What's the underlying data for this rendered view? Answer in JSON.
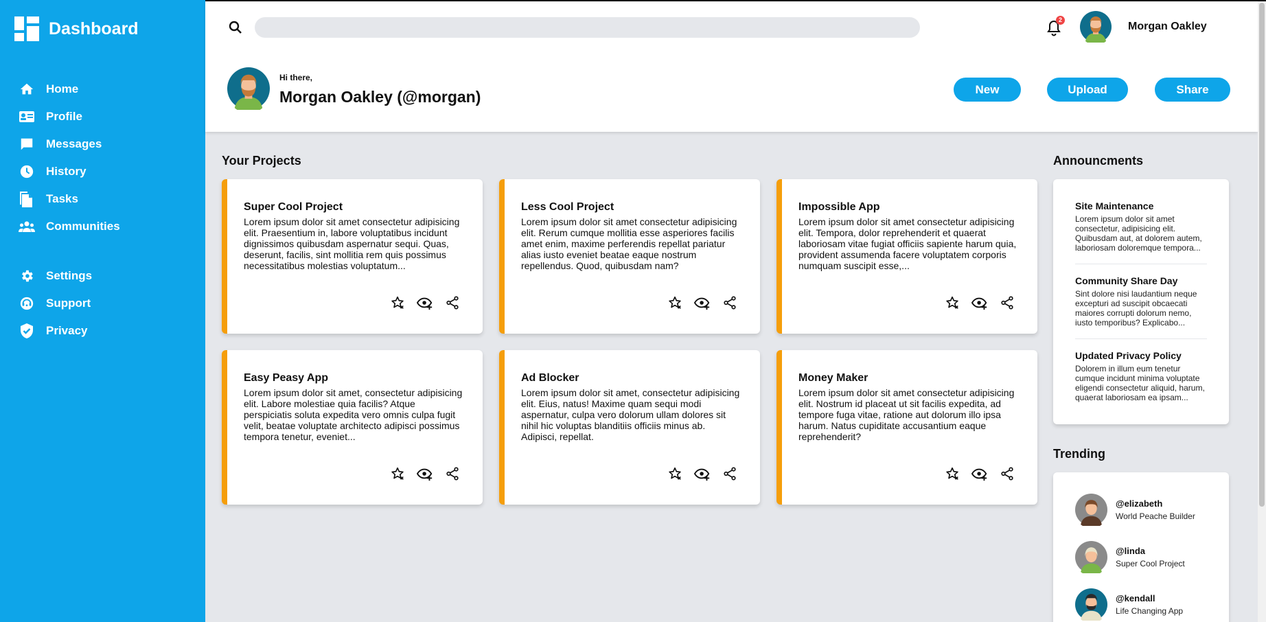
{
  "sidebar": {
    "title": "Dashboard",
    "nav_items": [
      {
        "label": "Home",
        "icon": "home-icon"
      },
      {
        "label": "Profile",
        "icon": "profile-card-icon"
      },
      {
        "label": "Messages",
        "icon": "message-icon"
      },
      {
        "label": "History",
        "icon": "clock-icon"
      },
      {
        "label": "Tasks",
        "icon": "document-icon"
      },
      {
        "label": "Communities",
        "icon": "group-icon"
      }
    ],
    "secondary_items": [
      {
        "label": "Settings",
        "icon": "gear-icon"
      },
      {
        "label": "Support",
        "icon": "support-icon"
      },
      {
        "label": "Privacy",
        "icon": "shield-icon"
      }
    ]
  },
  "header": {
    "search": {
      "placeholder": "",
      "value": ""
    },
    "notifications_count": "2",
    "username": "Morgan Oakley",
    "greeting": "Hi there,",
    "full_name": "Morgan Oakley (@morgan)",
    "buttons": {
      "new": "New",
      "upload": "Upload",
      "share": "Share"
    }
  },
  "projects": {
    "title": "Your Projects",
    "items": [
      {
        "title": "Super Cool Project",
        "text": "Lorem ipsum dolor sit amet consectetur adipisicing elit. Praesentium in, labore voluptatibus incidunt dignissimos quibusdam aspernatur sequi. Quas, deserunt, facilis, sint mollitia rem quis possimus necessitatibus molestias voluptatum..."
      },
      {
        "title": "Less Cool Project",
        "text": "Lorem ipsum dolor sit amet consectetur adipisicing elit. Rerum cumque mollitia esse asperiores facilis amet enim, maxime perferendis repellat pariatur alias iusto eveniet beatae eaque nostrum repellendus. Quod, quibusdam nam?"
      },
      {
        "title": "Impossible App",
        "text": "Lorem ipsum dolor sit amet consectetur adipisicing elit. Tempora, dolor reprehenderit et quaerat laboriosam vitae fugiat officiis sapiente harum quia, provident assumenda facere voluptatem corporis numquam suscipit esse,..."
      },
      {
        "title": "Easy Peasy App",
        "text": "Lorem ipsum dolor sit amet, consectetur adipisicing elit. Labore molestiae quia facilis? Atque perspiciatis soluta expedita vero omnis culpa fugit velit, beatae voluptate architecto adipisci possimus tempora tenetur, eveniet..."
      },
      {
        "title": "Ad Blocker",
        "text": "Lorem ipsum dolor sit amet, consectetur adipisicing elit. Eius, natus! Maxime quam sequi modi aspernatur, culpa vero dolorum ullam dolores sit nihil hic voluptas blanditiis officiis minus ab. Adipisci, repellat."
      },
      {
        "title": "Money Maker",
        "text": "Lorem ipsum dolor sit amet consectetur adipisicing elit. Nostrum id placeat ut sit facilis expedita, ad tempore fuga vitae, ratione aut dolorum illo ipsa harum. Natus cupiditate accusantium eaque reprehenderit?"
      }
    ]
  },
  "announcements": {
    "title": "Announcments",
    "items": [
      {
        "title": "Site Maintenance",
        "text": "Lorem ipsum dolor sit amet consectetur, adipisicing elit. Quibusdam aut, at dolorem autem, laboriosam doloremque tempora..."
      },
      {
        "title": "Community Share Day",
        "text": "Sint dolore nisi laudantium neque excepturi ad suscipit obcaecati maiores corrupti dolorum nemo, iusto temporibus? Explicabo..."
      },
      {
        "title": "Updated Privacy Policy",
        "text": "Dolorem in illum eum tenetur cumque incidunt minima voluptate eligendi consectetur aliquid, harum, quaerat laboriosam ea ipsam..."
      }
    ]
  },
  "trending": {
    "title": "Trending",
    "items": [
      {
        "handle": "@elizabeth",
        "subtitle": "World Peache Builder"
      },
      {
        "handle": "@linda",
        "subtitle": "Super Cool Project"
      },
      {
        "handle": "@kendall",
        "subtitle": "Life Changing App"
      }
    ]
  },
  "colors": {
    "sidebar": "#0ea5e9",
    "accent": "#f59e0b",
    "badge": "#ef4444"
  }
}
